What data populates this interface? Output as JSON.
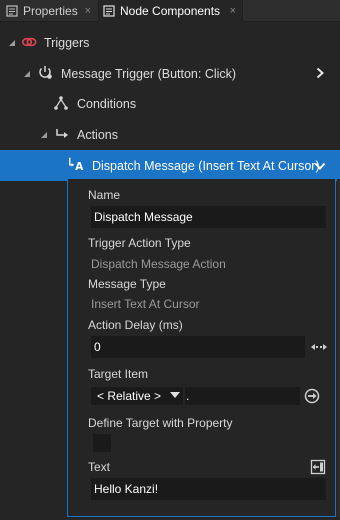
{
  "tabs": [
    {
      "label": "Properties",
      "close": "×"
    },
    {
      "label": "Node Components",
      "close": "×"
    }
  ],
  "tree": {
    "triggers": "Triggers",
    "message_trigger": "Message Trigger (Button: Click)",
    "conditions": "Conditions",
    "actions": "Actions",
    "dispatch_message": "Dispatch Message (Insert Text At Cursor)"
  },
  "details": {
    "name_label": "Name",
    "name_value": "Dispatch Message",
    "trigger_action_type_label": "Trigger Action Type",
    "trigger_action_type_value": "Dispatch Message Action",
    "message_type_label": "Message Type",
    "message_type_value": "Insert Text At Cursor",
    "action_delay_label": "Action Delay (ms)",
    "action_delay_value": "0",
    "target_item_label": "Target Item",
    "target_item_relative": "< Relative >",
    "target_item_path": ".",
    "define_target_label": "Define Target with Property",
    "define_target_checked": false,
    "text_label": "Text",
    "text_value": "Hello Kanzi!"
  },
  "colors": {
    "background": "#252526",
    "selection": "#1b74c5",
    "trigger_icon": "#e0464f",
    "field_bg": "#1a1a1a"
  },
  "icons": {
    "triggers": "trigger-link-icon",
    "message_trigger": "power-bell-icon",
    "conditions": "tree-hierarchy-icon",
    "actions": "arrow-right-curve-icon",
    "dispatch_message": "text-cursor-a-icon",
    "action_delay_side": "drag-horizontal-icon",
    "target_item_side": "go-to-target-icon",
    "text_side": "bind-import-icon"
  }
}
